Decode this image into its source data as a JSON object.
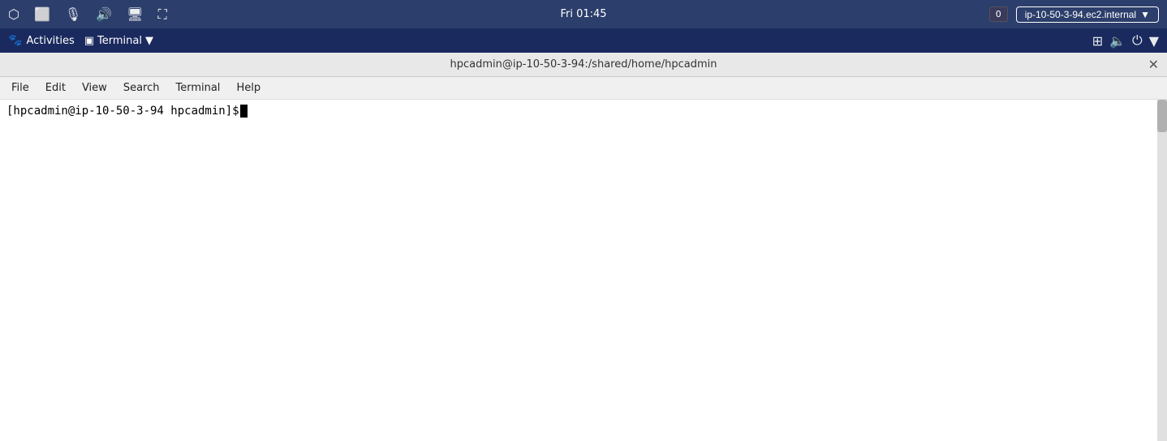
{
  "system_bar": {
    "time": "Fri 01:45",
    "notification_count": "0",
    "hostname": "ip-10-50-3-94.ec2.internal",
    "hostname_dropdown": "▼"
  },
  "activities_bar": {
    "activities_label": "Activities",
    "terminal_label": "Terminal",
    "terminal_dropdown": "▼"
  },
  "terminal": {
    "title": "hpcadmin@ip-10-50-3-94:/shared/home/hpcadmin",
    "close_label": "✕",
    "menu": {
      "file": "File",
      "edit": "Edit",
      "view": "View",
      "search": "Search",
      "terminal": "Terminal",
      "help": "Help"
    },
    "prompt": "[hpcadmin@ip-10-50-3-94 hpcadmin]$ "
  }
}
